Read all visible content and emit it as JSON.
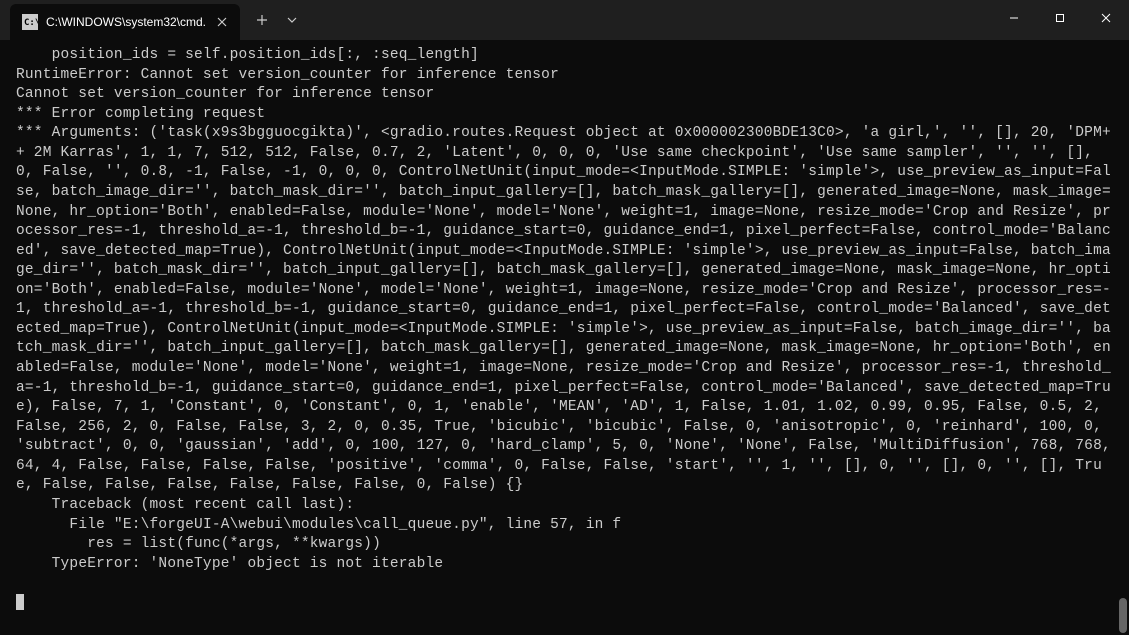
{
  "window": {
    "tab_title": "C:\\WINDOWS\\system32\\cmd.",
    "tab_icon_label": "cmd"
  },
  "terminal": {
    "lines": [
      "    position_ids = self.position_ids[:, :seq_length]",
      "RuntimeError: Cannot set version_counter for inference tensor",
      "Cannot set version_counter for inference tensor",
      "*** Error completing request",
      "*** Arguments: ('task(x9s3bgguocgikta)', <gradio.routes.Request object at 0x000002300BDE13C0>, 'a girl,', '', [], 20, 'DPM++ 2M Karras', 1, 1, 7, 512, 512, False, 0.7, 2, 'Latent', 0, 0, 0, 'Use same checkpoint', 'Use same sampler', '', '', [], 0, False, '', 0.8, -1, False, -1, 0, 0, 0, ControlNetUnit(input_mode=<InputMode.SIMPLE: 'simple'>, use_preview_as_input=False, batch_image_dir='', batch_mask_dir='', batch_input_gallery=[], batch_mask_gallery=[], generated_image=None, mask_image=None, hr_option='Both', enabled=False, module='None', model='None', weight=1, image=None, resize_mode='Crop and Resize', processor_res=-1, threshold_a=-1, threshold_b=-1, guidance_start=0, guidance_end=1, pixel_perfect=False, control_mode='Balanced', save_detected_map=True), ControlNetUnit(input_mode=<InputMode.SIMPLE: 'simple'>, use_preview_as_input=False, batch_image_dir='', batch_mask_dir='', batch_input_gallery=[], batch_mask_gallery=[], generated_image=None, mask_image=None, hr_option='Both', enabled=False, module='None', model='None', weight=1, image=None, resize_mode='Crop and Resize', processor_res=-1, threshold_a=-1, threshold_b=-1, guidance_start=0, guidance_end=1, pixel_perfect=False, control_mode='Balanced', save_detected_map=True), ControlNetUnit(input_mode=<InputMode.SIMPLE: 'simple'>, use_preview_as_input=False, batch_image_dir='', batch_mask_dir='', batch_input_gallery=[], batch_mask_gallery=[], generated_image=None, mask_image=None, hr_option='Both', enabled=False, module='None', model='None', weight=1, image=None, resize_mode='Crop and Resize', processor_res=-1, threshold_a=-1, threshold_b=-1, guidance_start=0, guidance_end=1, pixel_perfect=False, control_mode='Balanced', save_detected_map=True), False, 7, 1, 'Constant', 0, 'Constant', 0, 1, 'enable', 'MEAN', 'AD', 1, False, 1.01, 1.02, 0.99, 0.95, False, 0.5, 2, False, 256, 2, 0, False, False, 3, 2, 0, 0.35, True, 'bicubic', 'bicubic', False, 0, 'anisotropic', 0, 'reinhard', 100, 0, 'subtract', 0, 0, 'gaussian', 'add', 0, 100, 127, 0, 'hard_clamp', 5, 0, 'None', 'None', False, 'MultiDiffusion', 768, 768, 64, 4, False, False, False, False, 'positive', 'comma', 0, False, False, 'start', '', 1, '', [], 0, '', [], 0, '', [], True, False, False, False, False, False, False, 0, False) {}",
      "    Traceback (most recent call last):",
      "      File \"E:\\forgeUI-A\\webui\\modules\\call_queue.py\", line 57, in f",
      "        res = list(func(*args, **kwargs))",
      "    TypeError: 'NoneType' object is not iterable",
      ""
    ]
  }
}
